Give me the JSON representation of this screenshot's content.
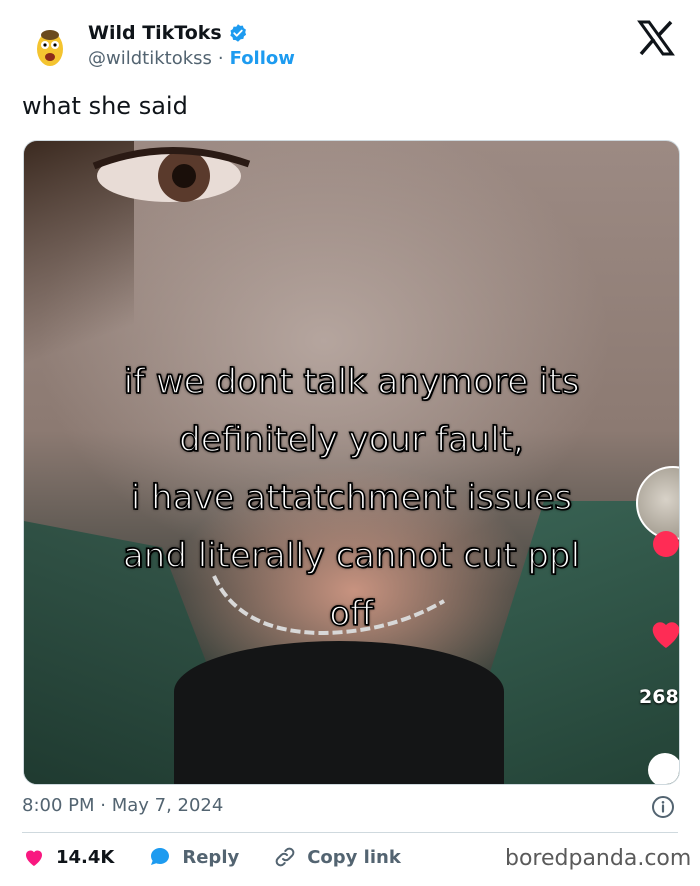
{
  "user": {
    "name": "Wild TikToks",
    "handle": "@wildtiktokss",
    "separator": "·",
    "follow_label": "Follow",
    "verified_color": "#1d9bf0"
  },
  "header": {
    "logo_icon": "x-logo-icon"
  },
  "tweet": {
    "text": "what she said",
    "media": {
      "overlay_lines": [
        "if we dont talk anymore its",
        "definitely your fault,",
        "i have attatchment issues",
        "and literally cannot cut ppl",
        "off"
      ],
      "side_like_count": "268"
    },
    "timestamp": "8:00 PM · May 7, 2024"
  },
  "actions": {
    "like_count": "14.4K",
    "reply_label": "Reply",
    "copy_label": "Copy link",
    "like_color": "#f91880",
    "reply_color": "#1d9bf0"
  },
  "watermark": "boredpanda.com"
}
